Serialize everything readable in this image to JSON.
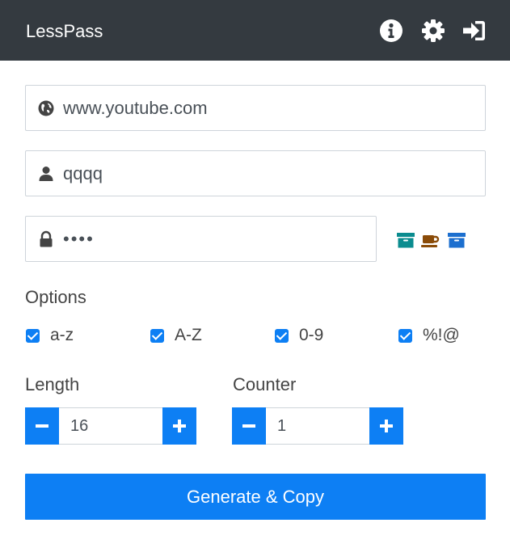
{
  "header": {
    "brand": "LessPass",
    "icons": [
      "info-circle-icon",
      "gear-icon",
      "sign-in-icon"
    ]
  },
  "form": {
    "site": {
      "value": "www.youtube.com",
      "icon": "globe-icon"
    },
    "login": {
      "value": "qqqq",
      "icon": "user-icon"
    },
    "master_password": {
      "value": "qqqq",
      "icon": "lock-icon"
    },
    "fingerprint": [
      {
        "icon": "archive-icon",
        "color": "#0b8c8f"
      },
      {
        "icon": "coffee-icon",
        "color": "#8a4b08"
      },
      {
        "icon": "archive-icon",
        "color": "#1c6fcf"
      }
    ]
  },
  "options": {
    "label": "Options",
    "items": [
      {
        "label": "a-z",
        "checked": true
      },
      {
        "label": "A-Z",
        "checked": true
      },
      {
        "label": "0-9",
        "checked": true
      },
      {
        "label": "%!@",
        "checked": true
      }
    ]
  },
  "length": {
    "label": "Length",
    "value": "16"
  },
  "counter": {
    "label": "Counter",
    "value": "1"
  },
  "generate_label": "Generate & Copy",
  "colors": {
    "header_bg": "#343a40",
    "accent": "#0d7ff4"
  }
}
